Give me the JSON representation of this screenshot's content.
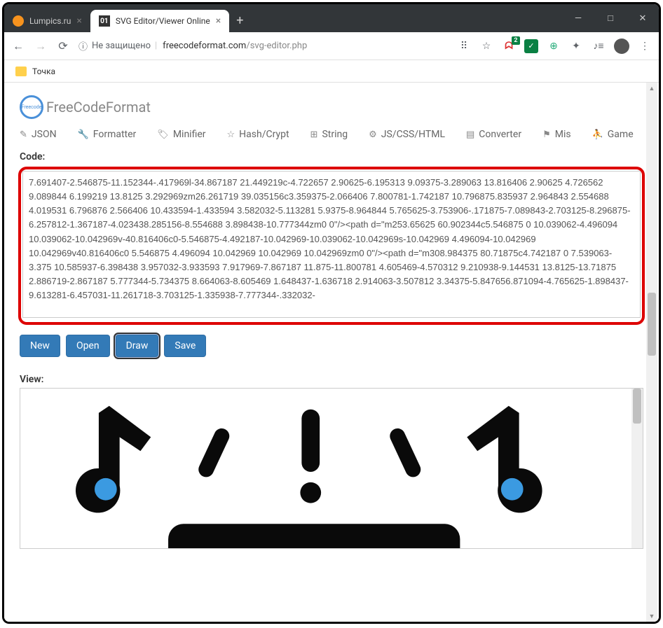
{
  "window": {
    "tabs": [
      {
        "title": "Lumpics.ru",
        "active": false
      },
      {
        "title": "SVG Editor/Viewer Online",
        "active": true,
        "badge": "01"
      }
    ],
    "controls": {
      "min": "—",
      "max": "□",
      "close": "✕"
    }
  },
  "addressbar": {
    "security_icon": "ⓘ",
    "security_label": "Не защищено",
    "separator": "|",
    "url_domain": "freecodeformat.com",
    "url_path": "/svg-editor.php"
  },
  "bookmarks": {
    "item1": "Точка"
  },
  "site": {
    "title": "FreeCodeFormat",
    "logo_text": "Freecode"
  },
  "menu": {
    "json": "JSON",
    "formatter": "Formatter",
    "minifier": "Minifier",
    "hash": "Hash/Crypt",
    "string": "String",
    "jscss": "JS/CSS/HTML",
    "converter": "Converter",
    "mis": "Mis",
    "game": "Game"
  },
  "labels": {
    "code": "Code:",
    "view": "View:"
  },
  "code_content": "7.691407-2.546875-11.152344-.417969l-34.867187 21.449219c-4.722657 2.90625-6.195313 9.09375-3.289063 13.816406 2.90625 4.726562 9.089844 6.199219 13.8125 3.292969zm26.261719 39.035156c3.359375-2.066406 7.800781-1.742187 10.796875.835937 2.964843 2.554688 4.019531 6.796876 2.566406 10.433594-1.433594 3.582032-5.113281 5.9375-8.964844 5.765625-3.753906-.171875-7.089843-2.703125-8.296875-6.257812-1.367187-4.023438.285156-8.554688 3.898438-10.777344zm0 0\"/><path d=\"m253.65625 60.902344c5.546875 0 10.039062-4.496094 10.039062-10.042969v-40.816406c0-5.546875-4.492187-10.042969-10.039062-10.042969s-10.042969 4.496094-10.042969 10.042969v40.816406c0 5.546875 4.496094 10.042969 10.042969 10.042969zm0 0\"/><path d=\"m308.984375 80.71875c4.742187 0 7.539063-3.375 10.585937-6.398438 3.957032-3.933593 7.917969-7.867187 11.875-11.800781 4.605469-4.570312 9.210938-9.144531 13.8125-13.71875 2.886719-2.867187 5.777344-5.734375 8.664063-8.605469 1.648437-1.636718 2.914063-3.507812 3.34375-5.847656.871094-4.765625-1.898437-9.613281-6.457031-11.261718-3.703125-1.335938-7.777344-.332032-",
  "buttons": {
    "new": "New",
    "open": "Open",
    "draw": "Draw",
    "save": "Save"
  }
}
